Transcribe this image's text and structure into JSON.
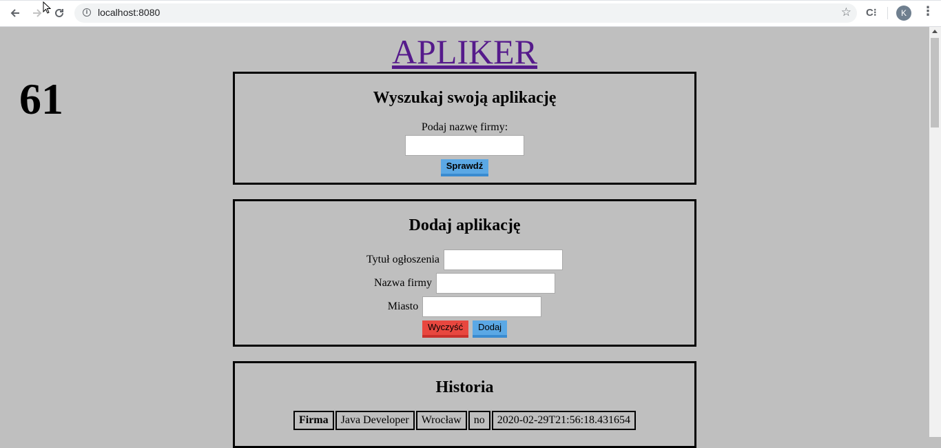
{
  "browser": {
    "url": "localhost:8080",
    "avatar_letter": "K",
    "ext_label": "C⁝"
  },
  "app": {
    "logo": "APLIKER",
    "counter": "61"
  },
  "search_card": {
    "title": "Wyszukaj swoją aplikację",
    "company_label": "Podaj nazwę firmy:",
    "company_value": "",
    "check_button": "Sprawdź"
  },
  "add_card": {
    "title": "Dodaj aplikację",
    "fields": [
      {
        "label": "Tytuł ogłoszenia",
        "value": ""
      },
      {
        "label": "Nazwa firmy",
        "value": ""
      },
      {
        "label": "Miasto",
        "value": ""
      }
    ],
    "clear_button": "Wyczyść",
    "add_button": "Dodaj"
  },
  "history_card": {
    "title": "Historia",
    "rows": [
      {
        "company_header": "Firma",
        "title": "Java Developer",
        "city": "Wrocław",
        "status": "no",
        "timestamp": "2020-02-29T21:56:18.431654"
      }
    ]
  },
  "colors": {
    "background": "#bfbfbf",
    "primary_button": "#5ba8e5",
    "danger_button": "#e8473f",
    "link": "#551a8b"
  }
}
